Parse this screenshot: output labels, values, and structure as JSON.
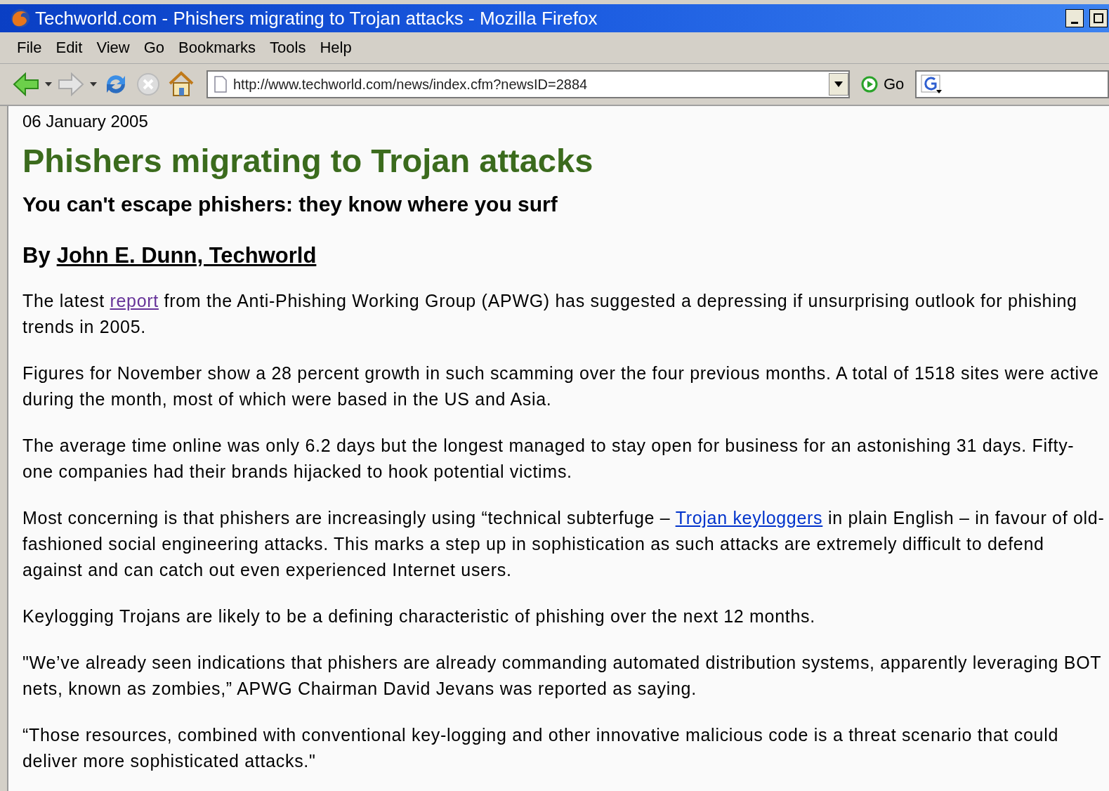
{
  "window": {
    "title": "Techworld.com - Phishers migrating to Trojan attacks - Mozilla Firefox"
  },
  "menu": [
    "File",
    "Edit",
    "View",
    "Go",
    "Bookmarks",
    "Tools",
    "Help"
  ],
  "toolbar": {
    "url": "http://www.techworld.com/news/index.cfm?newsID=2884",
    "go": "Go"
  },
  "article": {
    "date": "06 January 2005",
    "headline": "Phishers migrating to Trojan attacks",
    "standfirst": "You can't escape phishers: they know where you surf",
    "byline": {
      "prefix": "By",
      "author": "John E. Dunn, Techworld"
    },
    "paragraphs": [
      [
        {
          "kind": "text",
          "text": "The latest "
        },
        {
          "kind": "link",
          "text": "report",
          "visited": true
        },
        {
          "kind": "text",
          "text": " from the Anti-Phishing Working Group (APWG) has suggested a depressing if unsurprising outlook for phishing trends in 2005."
        }
      ],
      [
        {
          "kind": "text",
          "text": "Figures for November show a 28 percent growth in such scamming over the four previous months. A total of 1518 sites were active during the month, most of which were based in the US and Asia."
        }
      ],
      [
        {
          "kind": "text",
          "text": "The average time online was only 6.2 days but the longest managed to stay open for business for an astonishing 31 days. Fifty-one companies had their brands hijacked to hook potential victims."
        }
      ],
      [
        {
          "kind": "text",
          "text": "Most concerning is that phishers are increasingly using “technical subterfuge – "
        },
        {
          "kind": "link",
          "text": "Trojan keyloggers",
          "visited": false
        },
        {
          "kind": "text",
          "text": " in plain English – in favour of old-fashioned social engineering attacks. This marks a step up in sophistication as such attacks are extremely difficult to defend against and can catch out even experienced Internet users."
        }
      ],
      [
        {
          "kind": "text",
          "text": "Keylogging Trojans are likely to be a defining characteristic of phishing over the next 12 months."
        }
      ],
      [
        {
          "kind": "text",
          "text": "\"We’ve already seen indications that phishers are already commanding automated distribution systems, apparently leveraging BOT nets, known as zombies,” APWG Chairman David Jevans was reported as saying."
        }
      ],
      [
        {
          "kind": "text",
          "text": "“Those resources, combined with conventional key-logging and other innovative malicious code is a threat scenario that could deliver more sophisticated attacks.\""
        }
      ]
    ]
  }
}
